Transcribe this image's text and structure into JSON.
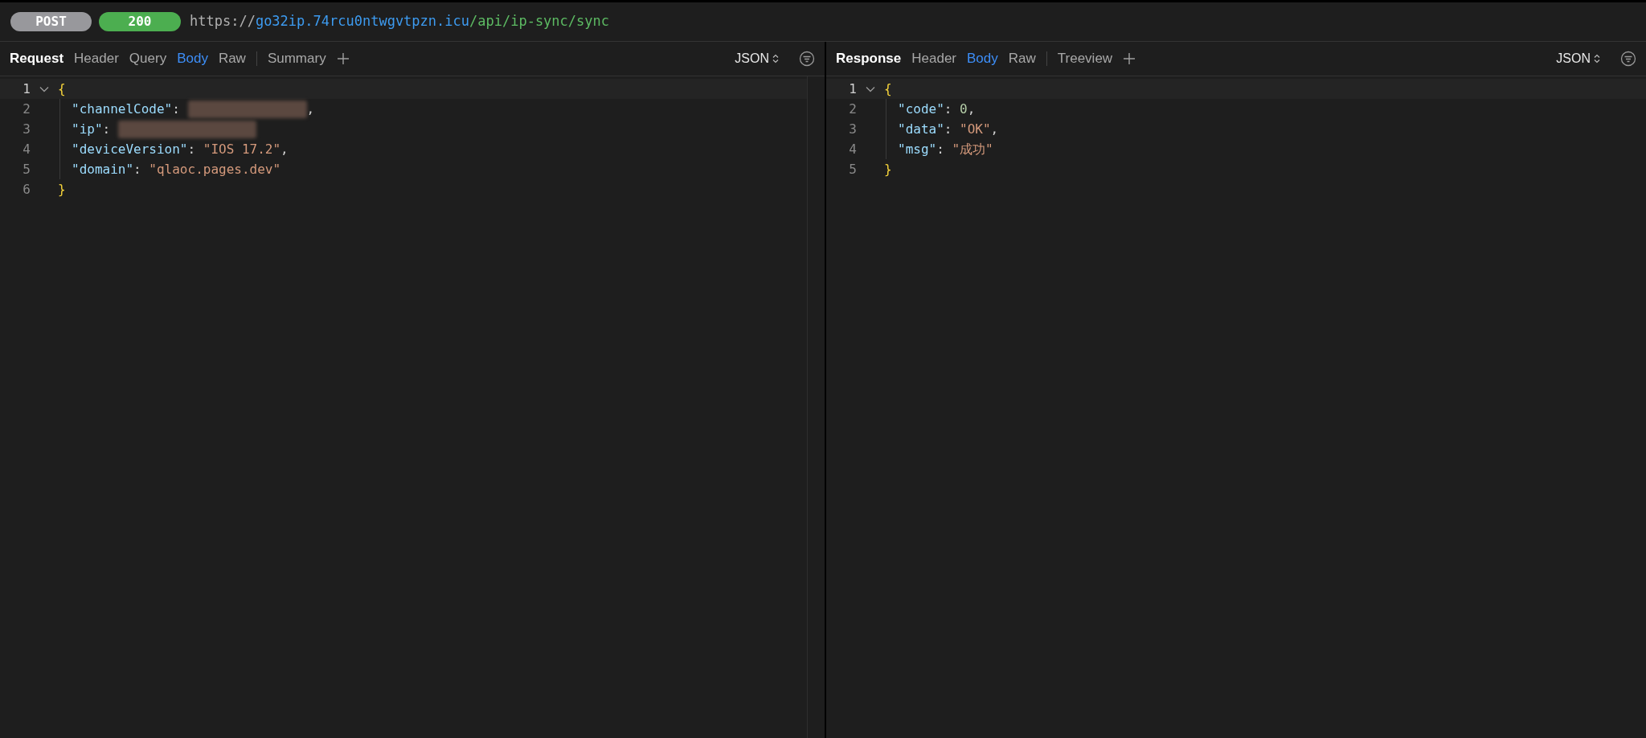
{
  "request_bar": {
    "method": "POST",
    "status": "200",
    "url": [
      {
        "kind": "scheme",
        "text": "https://"
      },
      {
        "kind": "host",
        "text": "go32ip.74rcu0ntwgvtpzn.icu"
      },
      {
        "kind": "path",
        "text": "/api/ip-sync/sync"
      }
    ]
  },
  "panels": [
    {
      "title": "Request",
      "tabs": [
        {
          "label": "Header",
          "selected": false,
          "kind": "tab"
        },
        {
          "label": "Query",
          "selected": false,
          "kind": "tab"
        },
        {
          "label": "Body",
          "selected": true,
          "kind": "tab"
        },
        {
          "label": "Raw",
          "selected": false,
          "kind": "tab"
        },
        {
          "label": "Summary",
          "selected": false,
          "kind": "separated"
        }
      ],
      "format": "JSON",
      "fold_expanded": true,
      "lines": [
        {
          "number": "1",
          "tokens": [
            {
              "kind": "brace",
              "text": "{"
            }
          ]
        },
        {
          "number": "2",
          "tokens": [
            {
              "kind": "key",
              "text": "\"channelCode\""
            },
            {
              "kind": "punct",
              "text": ": "
            },
            {
              "kind": "redacted"
            },
            {
              "kind": "punct",
              "text": ","
            }
          ]
        },
        {
          "number": "3",
          "tokens": [
            {
              "kind": "key",
              "text": "\"ip\""
            },
            {
              "kind": "punct",
              "text": ": "
            },
            {
              "kind": "redacted"
            }
          ]
        },
        {
          "number": "4",
          "tokens": [
            {
              "kind": "key",
              "text": "\"deviceVersion\""
            },
            {
              "kind": "punct",
              "text": ": "
            },
            {
              "kind": "string",
              "text": "\"IOS 17.2\""
            },
            {
              "kind": "punct",
              "text": ","
            }
          ]
        },
        {
          "number": "5",
          "tokens": [
            {
              "kind": "key",
              "text": "\"domain\""
            },
            {
              "kind": "punct",
              "text": ": "
            },
            {
              "kind": "string",
              "text": "\"qlaoc.pages.dev\""
            }
          ]
        },
        {
          "number": "6",
          "tokens": [
            {
              "kind": "brace",
              "text": "}"
            }
          ]
        }
      ]
    },
    {
      "title": "Response",
      "tabs": [
        {
          "label": "Header",
          "selected": false,
          "kind": "tab"
        },
        {
          "label": "Body",
          "selected": true,
          "kind": "tab"
        },
        {
          "label": "Raw",
          "selected": false,
          "kind": "tab"
        },
        {
          "label": "Treeview",
          "selected": false,
          "kind": "separated"
        }
      ],
      "format": "JSON",
      "fold_expanded": true,
      "lines": [
        {
          "number": "1",
          "tokens": [
            {
              "kind": "brace",
              "text": "{"
            }
          ]
        },
        {
          "number": "2",
          "tokens": [
            {
              "kind": "key",
              "text": "\"code\""
            },
            {
              "kind": "punct",
              "text": ": "
            },
            {
              "kind": "number",
              "text": "0"
            },
            {
              "kind": "punct",
              "text": ","
            }
          ]
        },
        {
          "number": "3",
          "tokens": [
            {
              "kind": "key",
              "text": "\"data\""
            },
            {
              "kind": "punct",
              "text": ": "
            },
            {
              "kind": "string",
              "text": "\"OK\""
            },
            {
              "kind": "punct",
              "text": ","
            }
          ]
        },
        {
          "number": "4",
          "tokens": [
            {
              "kind": "key",
              "text": "\"msg\""
            },
            {
              "kind": "punct",
              "text": ": "
            },
            {
              "kind": "string",
              "text": "\"成功\""
            }
          ]
        },
        {
          "number": "5",
          "tokens": [
            {
              "kind": "brace",
              "text": "}"
            }
          ]
        }
      ]
    }
  ]
}
